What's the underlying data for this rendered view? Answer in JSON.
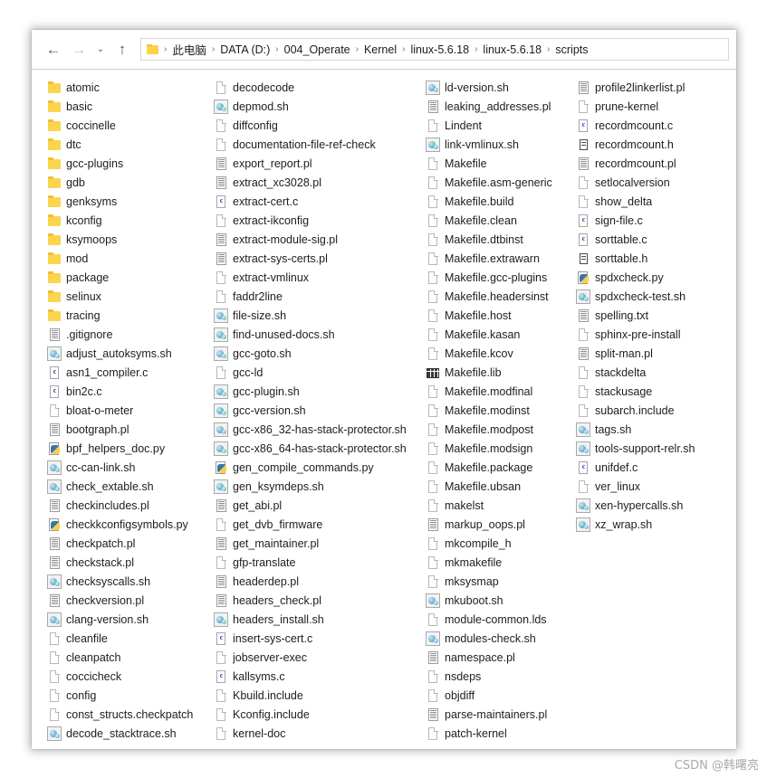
{
  "window": {
    "title": "scripts"
  },
  "nav": {
    "back_label": "←",
    "forward_label": "→",
    "history_label": "⌄",
    "up_label": "↑"
  },
  "breadcrumb": {
    "separator": "›",
    "items": [
      "此电脑",
      "DATA (D:)",
      "004_Operate",
      "Kernel",
      "linux-5.6.18",
      "linux-5.6.18",
      "scripts"
    ]
  },
  "columns": [
    {
      "entries": [
        {
          "name": "atomic",
          "icon": "folder"
        },
        {
          "name": "basic",
          "icon": "folder"
        },
        {
          "name": "coccinelle",
          "icon": "folder"
        },
        {
          "name": "dtc",
          "icon": "folder"
        },
        {
          "name": "gcc-plugins",
          "icon": "folder"
        },
        {
          "name": "gdb",
          "icon": "folder"
        },
        {
          "name": "genksyms",
          "icon": "folder"
        },
        {
          "name": "kconfig",
          "icon": "folder"
        },
        {
          "name": "ksymoops",
          "icon": "folder"
        },
        {
          "name": "mod",
          "icon": "folder"
        },
        {
          "name": "package",
          "icon": "folder"
        },
        {
          "name": "selinux",
          "icon": "folder"
        },
        {
          "name": "tracing",
          "icon": "folder"
        },
        {
          "name": ".gitignore",
          "icon": "doc"
        },
        {
          "name": "adjust_autoksyms.sh",
          "icon": "sh"
        },
        {
          "name": "asn1_compiler.c",
          "icon": "c"
        },
        {
          "name": "bin2c.c",
          "icon": "c"
        },
        {
          "name": "bloat-o-meter",
          "icon": "file"
        },
        {
          "name": "bootgraph.pl",
          "icon": "doc"
        },
        {
          "name": "bpf_helpers_doc.py",
          "icon": "py"
        },
        {
          "name": "cc-can-link.sh",
          "icon": "sh"
        },
        {
          "name": "check_extable.sh",
          "icon": "sh"
        },
        {
          "name": "checkincludes.pl",
          "icon": "doc"
        },
        {
          "name": "checkkconfigsymbols.py",
          "icon": "py"
        },
        {
          "name": "checkpatch.pl",
          "icon": "doc"
        },
        {
          "name": "checkstack.pl",
          "icon": "doc"
        },
        {
          "name": "checksyscalls.sh",
          "icon": "sh"
        },
        {
          "name": "checkversion.pl",
          "icon": "doc"
        },
        {
          "name": "clang-version.sh",
          "icon": "sh"
        },
        {
          "name": "cleanfile",
          "icon": "file"
        },
        {
          "name": "cleanpatch",
          "icon": "file"
        },
        {
          "name": "coccicheck",
          "icon": "file"
        },
        {
          "name": "config",
          "icon": "file"
        },
        {
          "name": "const_structs.checkpatch",
          "icon": "file"
        },
        {
          "name": "decode_stacktrace.sh",
          "icon": "sh"
        }
      ]
    },
    {
      "entries": [
        {
          "name": "decodecode",
          "icon": "file"
        },
        {
          "name": "depmod.sh",
          "icon": "sh"
        },
        {
          "name": "diffconfig",
          "icon": "file"
        },
        {
          "name": "documentation-file-ref-check",
          "icon": "file"
        },
        {
          "name": "export_report.pl",
          "icon": "doc"
        },
        {
          "name": "extract_xc3028.pl",
          "icon": "doc"
        },
        {
          "name": "extract-cert.c",
          "icon": "c"
        },
        {
          "name": "extract-ikconfig",
          "icon": "file"
        },
        {
          "name": "extract-module-sig.pl",
          "icon": "doc"
        },
        {
          "name": "extract-sys-certs.pl",
          "icon": "doc"
        },
        {
          "name": "extract-vmlinux",
          "icon": "file"
        },
        {
          "name": "faddr2line",
          "icon": "file"
        },
        {
          "name": "file-size.sh",
          "icon": "sh"
        },
        {
          "name": "find-unused-docs.sh",
          "icon": "sh"
        },
        {
          "name": "gcc-goto.sh",
          "icon": "sh"
        },
        {
          "name": "gcc-ld",
          "icon": "file"
        },
        {
          "name": "gcc-plugin.sh",
          "icon": "sh"
        },
        {
          "name": "gcc-version.sh",
          "icon": "sh"
        },
        {
          "name": "gcc-x86_32-has-stack-protector.sh",
          "icon": "sh"
        },
        {
          "name": "gcc-x86_64-has-stack-protector.sh",
          "icon": "sh"
        },
        {
          "name": "gen_compile_commands.py",
          "icon": "py"
        },
        {
          "name": "gen_ksymdeps.sh",
          "icon": "sh"
        },
        {
          "name": "get_abi.pl",
          "icon": "doc"
        },
        {
          "name": "get_dvb_firmware",
          "icon": "file"
        },
        {
          "name": "get_maintainer.pl",
          "icon": "doc"
        },
        {
          "name": "gfp-translate",
          "icon": "file"
        },
        {
          "name": "headerdep.pl",
          "icon": "doc"
        },
        {
          "name": "headers_check.pl",
          "icon": "doc"
        },
        {
          "name": "headers_install.sh",
          "icon": "sh"
        },
        {
          "name": "insert-sys-cert.c",
          "icon": "c"
        },
        {
          "name": "jobserver-exec",
          "icon": "file"
        },
        {
          "name": "kallsyms.c",
          "icon": "c"
        },
        {
          "name": "Kbuild.include",
          "icon": "file"
        },
        {
          "name": "Kconfig.include",
          "icon": "file"
        },
        {
          "name": "kernel-doc",
          "icon": "file"
        }
      ]
    },
    {
      "entries": [
        {
          "name": "ld-version.sh",
          "icon": "sh"
        },
        {
          "name": "leaking_addresses.pl",
          "icon": "doc"
        },
        {
          "name": "Lindent",
          "icon": "file"
        },
        {
          "name": "link-vmlinux.sh",
          "icon": "sh"
        },
        {
          "name": "Makefile",
          "icon": "file"
        },
        {
          "name": "Makefile.asm-generic",
          "icon": "file"
        },
        {
          "name": "Makefile.build",
          "icon": "file"
        },
        {
          "name": "Makefile.clean",
          "icon": "file"
        },
        {
          "name": "Makefile.dtbinst",
          "icon": "file"
        },
        {
          "name": "Makefile.extrawarn",
          "icon": "file"
        },
        {
          "name": "Makefile.gcc-plugins",
          "icon": "file"
        },
        {
          "name": "Makefile.headersinst",
          "icon": "file"
        },
        {
          "name": "Makefile.host",
          "icon": "file"
        },
        {
          "name": "Makefile.kasan",
          "icon": "file"
        },
        {
          "name": "Makefile.kcov",
          "icon": "file"
        },
        {
          "name": "Makefile.lib",
          "icon": "lib"
        },
        {
          "name": "Makefile.modfinal",
          "icon": "file"
        },
        {
          "name": "Makefile.modinst",
          "icon": "file"
        },
        {
          "name": "Makefile.modpost",
          "icon": "file"
        },
        {
          "name": "Makefile.modsign",
          "icon": "file"
        },
        {
          "name": "Makefile.package",
          "icon": "file"
        },
        {
          "name": "Makefile.ubsan",
          "icon": "file"
        },
        {
          "name": "makelst",
          "icon": "file"
        },
        {
          "name": "markup_oops.pl",
          "icon": "doc"
        },
        {
          "name": "mkcompile_h",
          "icon": "file"
        },
        {
          "name": "mkmakefile",
          "icon": "file"
        },
        {
          "name": "mksysmap",
          "icon": "file"
        },
        {
          "name": "mkuboot.sh",
          "icon": "sh"
        },
        {
          "name": "module-common.lds",
          "icon": "file"
        },
        {
          "name": "modules-check.sh",
          "icon": "sh"
        },
        {
          "name": "namespace.pl",
          "icon": "doc"
        },
        {
          "name": "nsdeps",
          "icon": "file"
        },
        {
          "name": "objdiff",
          "icon": "file"
        },
        {
          "name": "parse-maintainers.pl",
          "icon": "doc"
        },
        {
          "name": "patch-kernel",
          "icon": "file"
        }
      ]
    },
    {
      "entries": [
        {
          "name": "profile2linkerlist.pl",
          "icon": "doc"
        },
        {
          "name": "prune-kernel",
          "icon": "file"
        },
        {
          "name": "recordmcount.c",
          "icon": "c"
        },
        {
          "name": "recordmcount.h",
          "icon": "h"
        },
        {
          "name": "recordmcount.pl",
          "icon": "doc"
        },
        {
          "name": "setlocalversion",
          "icon": "file"
        },
        {
          "name": "show_delta",
          "icon": "file"
        },
        {
          "name": "sign-file.c",
          "icon": "c"
        },
        {
          "name": "sorttable.c",
          "icon": "c"
        },
        {
          "name": "sorttable.h",
          "icon": "h"
        },
        {
          "name": "spdxcheck.py",
          "icon": "py"
        },
        {
          "name": "spdxcheck-test.sh",
          "icon": "sh"
        },
        {
          "name": "spelling.txt",
          "icon": "doc"
        },
        {
          "name": "sphinx-pre-install",
          "icon": "file"
        },
        {
          "name": "split-man.pl",
          "icon": "doc"
        },
        {
          "name": "stackdelta",
          "icon": "file"
        },
        {
          "name": "stackusage",
          "icon": "file"
        },
        {
          "name": "subarch.include",
          "icon": "file"
        },
        {
          "name": "tags.sh",
          "icon": "sh"
        },
        {
          "name": "tools-support-relr.sh",
          "icon": "sh"
        },
        {
          "name": "unifdef.c",
          "icon": "c"
        },
        {
          "name": "ver_linux",
          "icon": "file"
        },
        {
          "name": "xen-hypercalls.sh",
          "icon": "sh"
        },
        {
          "name": "xz_wrap.sh",
          "icon": "sh"
        }
      ]
    }
  ],
  "watermark": {
    "text": "CSDN @韩曙亮"
  }
}
